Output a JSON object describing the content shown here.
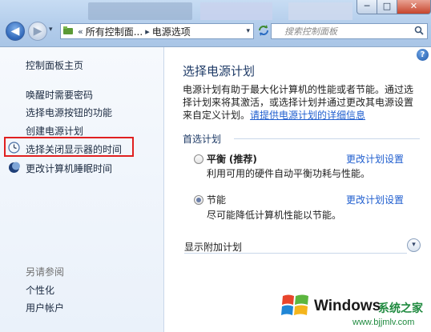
{
  "titlebar": {
    "minimize_glyph": "─",
    "maximize_glyph": "□",
    "close_glyph": "✕"
  },
  "nav": {
    "back_glyph": "◀",
    "forward_glyph": "▶",
    "history_glyph": "▾"
  },
  "address": {
    "separator_1": "«",
    "crumb_1": "所有控制面...",
    "separator_2": "▸",
    "crumb_2": "电源选项",
    "dropdown_glyph": "▾"
  },
  "search": {
    "placeholder": "搜索控制面板"
  },
  "left_pane": {
    "home": "控制面板主页",
    "links": [
      "唤醒时需要密码",
      "选择电源按钮的功能",
      "创建电源计划",
      "选择关闭显示器的时间",
      "更改计算机睡眠时间"
    ],
    "see_also_title": "另请参阅",
    "see_also_links": [
      "个性化",
      "用户帐户"
    ]
  },
  "main": {
    "help_glyph": "?",
    "title": "选择电源计划",
    "description": "电源计划有助于最大化计算机的性能或者节能。通过选择计划来将其激活，或选择计划并通过更改其电源设置来自定义计划。",
    "description_link": "请提供电源计划的详细信息",
    "group_label": "首选计划",
    "plans": [
      {
        "name": "平衡",
        "tag": "(推荐)",
        "description": "利用可用的硬件自动平衡功耗与性能。",
        "change_link": "更改计划设置",
        "selected": false
      },
      {
        "name": "节能",
        "tag": "",
        "description": "尽可能降低计算机性能以节能。",
        "change_link": "更改计划设置",
        "selected": true
      }
    ],
    "extra_plans_label": "显示附加计划",
    "expand_glyph": "▾"
  },
  "watermark": {
    "brand": "Windows",
    "cn": "系统之家",
    "url": "www.bjjmlv.com"
  },
  "colors": {
    "link": "#1f5ecf",
    "highlight_box": "#e02020",
    "watermark_green": "#1f8a3f"
  }
}
